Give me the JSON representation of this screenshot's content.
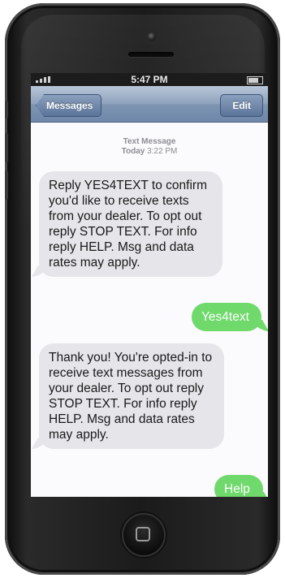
{
  "status_bar": {
    "time": "5:47 PM"
  },
  "nav": {
    "back_label": "Messages",
    "edit_label": "Edit"
  },
  "thread": {
    "header_label": "Text Message",
    "header_day": "Today",
    "header_time": "3:22 PM"
  },
  "messages": [
    {
      "direction": "incoming",
      "text": "Reply YES4TEXT to confirm you'd like to receive texts from your dealer. To opt out reply STOP TEXT. For info reply HELP. Msg and data rates may apply."
    },
    {
      "direction": "outgoing",
      "text": "Yes4text"
    },
    {
      "direction": "incoming",
      "text": "Thank you! You're opted-in to receive text messages from your dealer. To opt out reply STOP TEXT. For info reply HELP. Msg and data rates may apply."
    },
    {
      "direction": "outgoing",
      "text": "Help"
    }
  ],
  "colors": {
    "incoming_bubble": "#e5e5ea",
    "outgoing_bubble": "#6fd96b",
    "nav_bar": "#7f95b3"
  }
}
